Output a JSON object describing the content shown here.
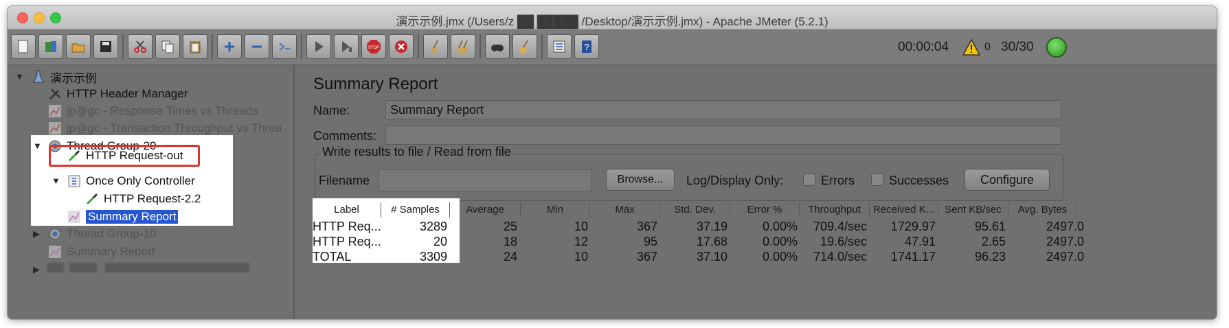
{
  "window": {
    "title": "演示示例.jmx (/Users/z ██  █████ /Desktop/演示示例.jmx) - Apache JMeter (5.2.1)"
  },
  "toolbar": {
    "elapsed_time": "00:00:04",
    "warning_count": "0",
    "thread_count": "30/30",
    "buttons": [
      "new-icon",
      "templates-icon",
      "open-icon",
      "save-icon",
      "cut-icon",
      "copy-icon",
      "paste-icon",
      "expand-icon",
      "collapse-icon",
      "toggle-icon",
      "start-icon",
      "start-no-pauses-icon",
      "stop-icon",
      "shutdown-icon",
      "clear-icon",
      "clear-all-icon",
      "search-icon",
      "reset-search-icon",
      "function-helper-icon",
      "help-icon"
    ]
  },
  "tree": {
    "root": "演示示例",
    "items": [
      {
        "label": "HTTP Header Manager"
      },
      {
        "label": "jp@gc - Response Times vs Threads"
      },
      {
        "label": "jp@gc - Transaction Throughput vs Threa"
      },
      {
        "label": "Thread Group-20"
      },
      {
        "label": "HTTP Request-out"
      },
      {
        "label": "Once Only Controller"
      },
      {
        "label": "HTTP Request-2.2"
      },
      {
        "label": "Summary Report"
      },
      {
        "label": "Thread Group-10"
      },
      {
        "label": "Summary Report"
      }
    ]
  },
  "panel": {
    "heading": "Summary Report",
    "name_label": "Name:",
    "name_value": "Summary Report",
    "comments_label": "Comments:",
    "comments_value": "",
    "file_group_title": "Write results to file / Read from file",
    "filename_label": "Filename",
    "filename_value": "",
    "browse_label": "Browse...",
    "log_display_label": "Log/Display Only:",
    "errors_label": "Errors",
    "successes_label": "Successes",
    "configure_label": "Configure"
  },
  "table": {
    "headers": [
      "Label",
      "# Samples",
      "Average",
      "Min",
      "Max",
      "Std. Dev.",
      "Error %",
      "Throughput",
      "Received K...",
      "Sent KB/sec",
      "Avg. Bytes"
    ],
    "rows": [
      [
        "HTTP Req...",
        "3289",
        "25",
        "10",
        "367",
        "37.19",
        "0.00%",
        "709.4/sec",
        "1729.97",
        "95.61",
        "2497.0"
      ],
      [
        "HTTP Req...",
        "20",
        "18",
        "12",
        "95",
        "17.68",
        "0.00%",
        "19.6/sec",
        "47.91",
        "2.65",
        "2497.0"
      ],
      [
        "TOTAL",
        "3309",
        "24",
        "10",
        "367",
        "37.10",
        "0.00%",
        "714.0/sec",
        "1741.17",
        "96.23",
        "2497.0"
      ]
    ]
  }
}
